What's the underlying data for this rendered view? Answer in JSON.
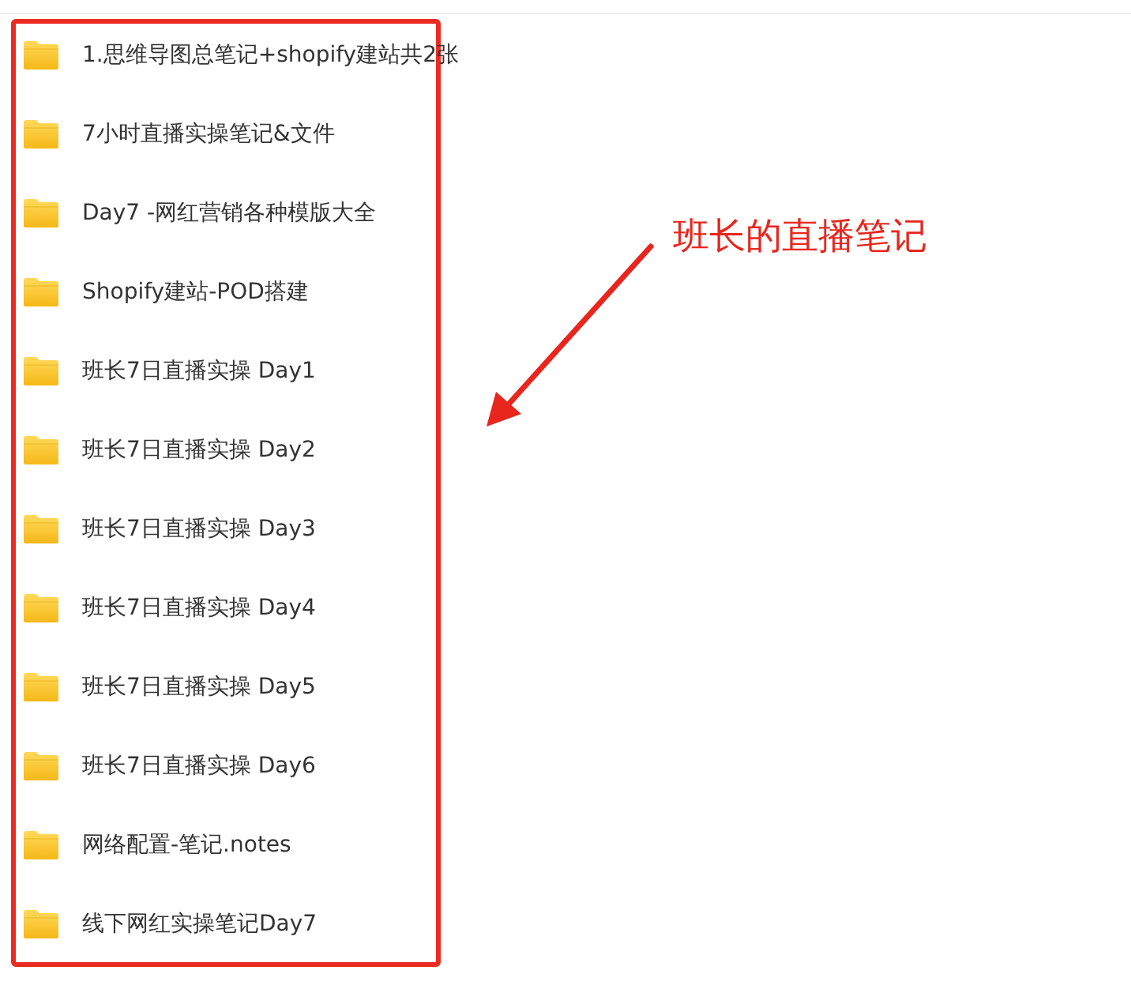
{
  "folders": [
    {
      "name": "1.思维导图总笔记+shopify建站共2张"
    },
    {
      "name": "7小时直播实操笔记&文件"
    },
    {
      "name": "Day7 -网红营销各种模版大全"
    },
    {
      "name": "Shopify建站-POD搭建"
    },
    {
      "name": "班长7日直播实操 Day1"
    },
    {
      "name": "班长7日直播实操 Day2"
    },
    {
      "name": "班长7日直播实操 Day3"
    },
    {
      "name": "班长7日直播实操 Day4"
    },
    {
      "name": "班长7日直播实操 Day5"
    },
    {
      "name": "班长7日直播实操 Day6"
    },
    {
      "name": "网络配置-笔记.notes"
    },
    {
      "name": "线下网红实操笔记Day7"
    }
  ],
  "annotation": {
    "text": "班长的直播笔记"
  }
}
